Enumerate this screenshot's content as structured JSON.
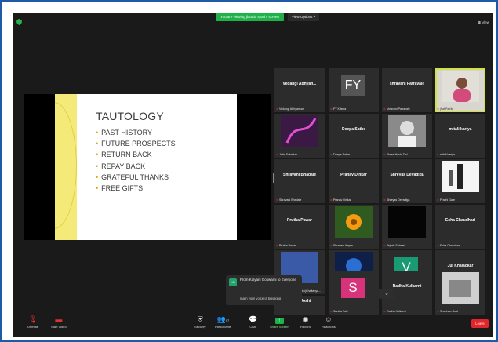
{
  "top": {
    "banner": "You are viewing jbsuda spad's screen",
    "view_options": "View Options ~",
    "view_label": "View"
  },
  "slide": {
    "title": "TAUTOLOGY",
    "items": [
      "PAST HISTORY",
      "FUTURE PROSPECTS",
      "RETURN BACK",
      "REPAY BACK",
      "GRATEFUL THANKS",
      "FREE GIFTS"
    ]
  },
  "participants": [
    {
      "big": "Vedangi  Abhyan...",
      "cap": "Vedangi Abhyankar"
    },
    {
      "letters": "FY",
      "cap": "FY Kitswa"
    },
    {
      "big": "shravani Patravale",
      "cap": "shravani Patravale"
    },
    {
      "cap": "jfrat Patrik"
    },
    {
      "cap": "Jatin Satoskar"
    },
    {
      "big": "Deepa Sathe",
      "cap": "Deepa Sathe"
    },
    {
      "cap": "Shree Hrishi Tad"
    },
    {
      "big": "mitali kariya",
      "cap": "mitali kariya"
    },
    {
      "big": "Shravani Bhadale",
      "cap": "Shravani Bhadale"
    },
    {
      "big": "Pranav Dinkar",
      "cap": "Pranav Dinkar"
    },
    {
      "big": "Shreyas Devadiga",
      "cap": "Shreyas Devadiga"
    },
    {
      "cap": "Prachi Gate"
    },
    {
      "big": "Prutha Pawar",
      "cap": "Prutha Pawar"
    },
    {
      "cap": "Shravani Kapur"
    },
    {
      "cap": "Tejesh Shirsat"
    },
    {
      "big": "Echa Chaudhari",
      "cap": "Echa Chaudhari"
    },
    {
      "cap": "Chaitanyadeshmukh(Chaitanya..."
    },
    {
      "cap": "Tanaya Joshi"
    },
    {
      "letters": "V",
      "cap": "Vinaya Sahasrabudhe"
    },
    {
      "big": "Jui Khaladkar",
      "cap": "Jui Khaladkar"
    },
    {
      "big": "Karan Joshi",
      "cap": "Karan Joshi"
    },
    {
      "letters": "S",
      "cap": "Sanika Tulli"
    },
    {
      "big": "Radha Kulkarni",
      "cap": "Radha Kulkarni"
    },
    {
      "cap": "Shubham Joal"
    }
  ],
  "chat": {
    "initials": "KG",
    "from": "From Kalyani Goswami to Everyone",
    "message": "mam your voice is breaking"
  },
  "toolbar": {
    "unmute": "Unmute",
    "start_video": "Start Video",
    "security": "Security",
    "participants": "Participants",
    "participants_count": "97",
    "chat": "Chat",
    "share_screen": "Share Screen",
    "record": "Record",
    "reactions": "Reactions",
    "end": "Leave"
  },
  "colors": {
    "banner": "#1fb24a",
    "active_border": "#cfe24b",
    "end": "#e0262b",
    "frame": "#1e5aa8"
  }
}
